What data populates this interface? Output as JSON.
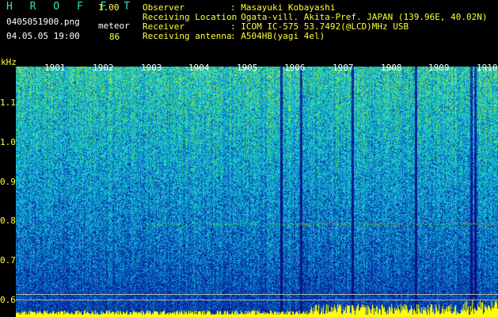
{
  "header": {
    "app_title": "H R O F F T",
    "app_version": "1.00",
    "filename": "0405051900.png",
    "datetime": "04.05.05 19:00",
    "meteor_label": "meteor",
    "meteor_count": "86"
  },
  "info": [
    {
      "key": "Observer",
      "value": ": Masayuki Kobayashi"
    },
    {
      "key": "Receiving Location",
      "value": ": Ogata-vill. Akita-Pref. JAPAN (139.96E, 40.02N)"
    },
    {
      "key": "Receiver",
      "value": ": ICOM IC-575 53.7492(@LCD)MHz USB"
    },
    {
      "key": "Receiving antenna",
      "value": ": A504HB(yagi 4el)"
    }
  ],
  "chart_data": {
    "type": "heatmap",
    "ylabel": "kHz",
    "y_ticks": [
      "1.1",
      "1.0",
      "0.9",
      "0.8",
      "0.7",
      "0.6"
    ],
    "x_ticks": [
      "1901",
      "1902",
      "1903",
      "1904",
      "1905",
      "1906",
      "1907",
      "1908",
      "1909",
      "1910"
    ]
  },
  "colors": {
    "background": "#000000",
    "spectrum_low": "#0a2a8c",
    "spectrum_mid": "#1faad0",
    "spectrum_high": "#30e040",
    "signal": "#ff3030",
    "baseline": "#ffff00",
    "label": "#ffff33"
  }
}
